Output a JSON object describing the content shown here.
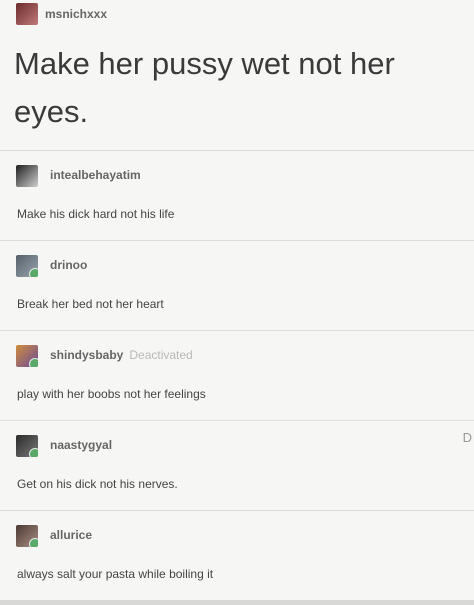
{
  "post": {
    "username": "msnichxxx",
    "title": "Make her pussy wet not her eyes."
  },
  "replies": [
    {
      "username": "intealbehayatim",
      "status": "",
      "text": "Make his dick hard not his life",
      "colors": [
        "#1f1f1f",
        "#cfcfcf"
      ]
    },
    {
      "username": "drinoo",
      "status": "",
      "text": "Break her bed not her heart",
      "colors": [
        "#55606a",
        "#9aa6ae"
      ]
    },
    {
      "username": "shindysbaby",
      "status": "Deactivated",
      "text": "play with her boobs not her feelings",
      "colors": [
        "#d08b3a",
        "#6b4d9c"
      ]
    },
    {
      "username": "naastygyal",
      "status": "",
      "text": "Get on his dick not his nerves.",
      "colors": [
        "#2b2b2b",
        "#7a7a7a"
      ]
    },
    {
      "username": "allurice",
      "status": "",
      "text": "always salt your pasta while boiling it",
      "colors": [
        "#4b3a33",
        "#a98f84"
      ]
    }
  ],
  "side_glyphs": [
    "",
    "D",
    ""
  ],
  "colors": {
    "background": "#f6f6f4",
    "badge_green": "#5aa86a"
  }
}
